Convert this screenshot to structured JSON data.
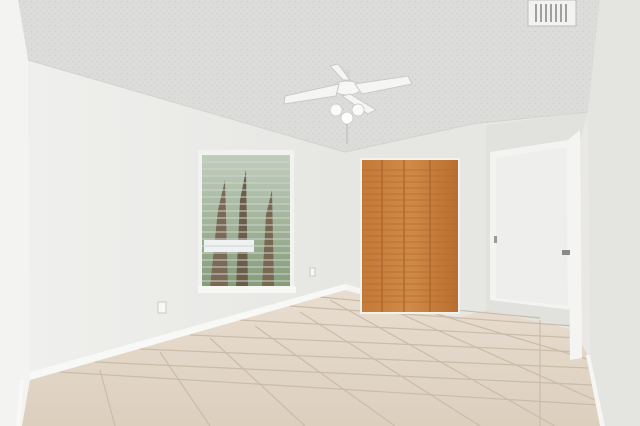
{
  "scene": {
    "description_kind": "photo",
    "colors": {
      "ceiling": "#dcdcda",
      "wall_left": "#ededeb",
      "wall_back": "#e7e7e4",
      "wall_right": "#e3e3e0",
      "floor_tile": "#e2d6c8",
      "grout": "#cdbfae",
      "closet_wood": "#c9803d",
      "closet_wood_dark": "#a85f24",
      "baseboard": "#f7f7f5",
      "window_frame": "#f2f2f0",
      "door": "#f1f1ef"
    },
    "icons": [
      "ceiling-fan-icon",
      "vent-icon",
      "outlet-icon",
      "door-hinge-icon"
    ]
  }
}
